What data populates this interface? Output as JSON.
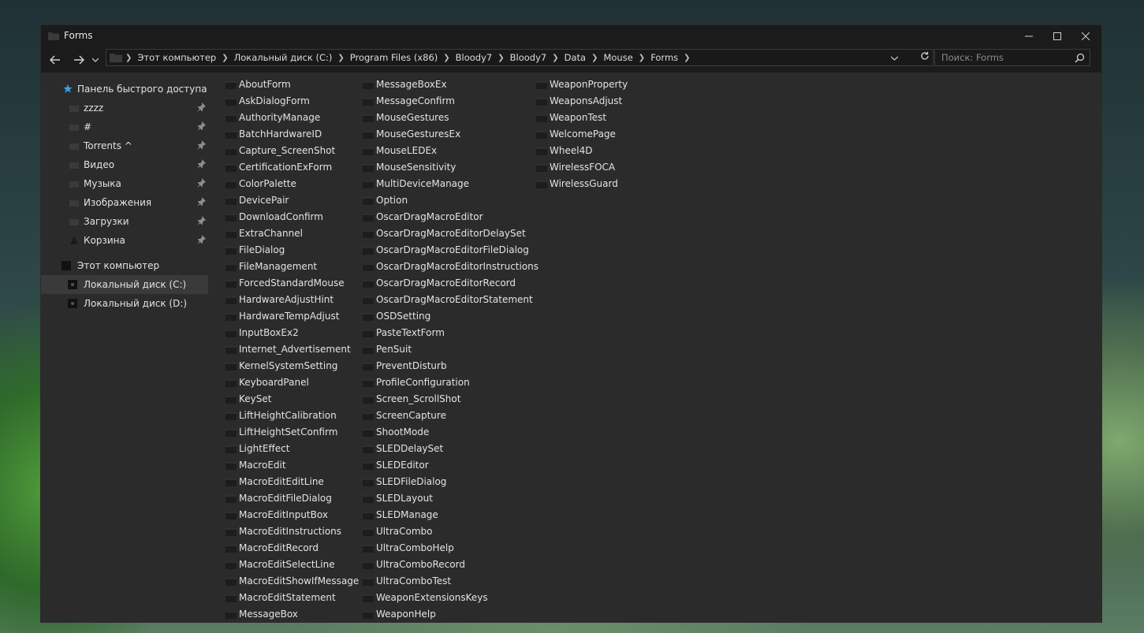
{
  "window": {
    "title": "Forms"
  },
  "address": {
    "segments": [
      "Этот компьютер",
      "Локальный диск (C:)",
      "Program Files (x86)",
      "Bloody7",
      "Bloody7",
      "Data",
      "Mouse",
      "Forms"
    ]
  },
  "search": {
    "placeholder": "Поиск: Forms"
  },
  "sidebar": {
    "quick_access": "Панель быстрого доступа",
    "pinned": [
      "zzzz",
      "#",
      "Torrents ^",
      "Видео",
      "Музыка",
      "Изображения",
      "Загрузки",
      "Корзина"
    ],
    "this_pc": "Этот компьютер",
    "drives": [
      "Локальный диск (C:)",
      "Локальный диск (D:)"
    ]
  },
  "files": {
    "col1": [
      "AboutForm",
      "AskDialogForm",
      "AuthorityManage",
      "BatchHardwareID",
      "Capture_ScreenShot",
      "CertificationExForm",
      "ColorPalette",
      "DevicePair",
      "DownloadConfirm",
      "ExtraChannel",
      "FileDialog",
      "FileManagement",
      "ForcedStandardMouse",
      "HardwareAdjustHint",
      "HardwareTempAdjust",
      "InputBoxEx2",
      "Internet_Advertisement",
      "KernelSystemSetting",
      "KeyboardPanel",
      "KeySet",
      "LiftHeightCalibration",
      "LiftHeightSetConfirm",
      "LightEffect",
      "MacroEdit",
      "MacroEditEditLine",
      "MacroEditFileDialog",
      "MacroEditInputBox",
      "MacroEditInstructions",
      "MacroEditRecord",
      "MacroEditSelectLine",
      "MacroEditShowIfMessage",
      "MacroEditStatement",
      "MessageBox"
    ],
    "col2": [
      "MessageBoxEx",
      "MessageConfirm",
      "MouseGestures",
      "MouseGesturesEx",
      "MouseLEDEx",
      "MouseSensitivity",
      "MultiDeviceManage",
      "Option",
      "OscarDragMacroEditor",
      "OscarDragMacroEditorDelaySet",
      "OscarDragMacroEditorFileDialog",
      "OscarDragMacroEditorInstructions",
      "OscarDragMacroEditorRecord",
      "OscarDragMacroEditorStatement",
      "OSDSetting",
      "PasteTextForm",
      "PenSuit",
      "PreventDisturb",
      "ProfileConfiguration",
      "Screen_ScrollShot",
      "ScreenCapture",
      "ShootMode",
      "SLEDDelaySet",
      "SLEDEditor",
      "SLEDFileDialog",
      "SLEDLayout",
      "SLEDManage",
      "UltraCombo",
      "UltraComboHelp",
      "UltraComboRecord",
      "UltraComboTest",
      "WeaponExtensionsKeys",
      "WeaponHelp"
    ],
    "col3": [
      "WeaponProperty",
      "WeaponsAdjust",
      "WeaponTest",
      "WelcomePage",
      "Wheel4D",
      "WirelessFOCA",
      "WirelessGuard"
    ]
  },
  "colors": {
    "window_bg": "#2b2b2b",
    "titlebar": "#1b1b1b",
    "text": "#e3e3e3",
    "selected": "#3a3a3a",
    "star": "#3aa0e8"
  }
}
